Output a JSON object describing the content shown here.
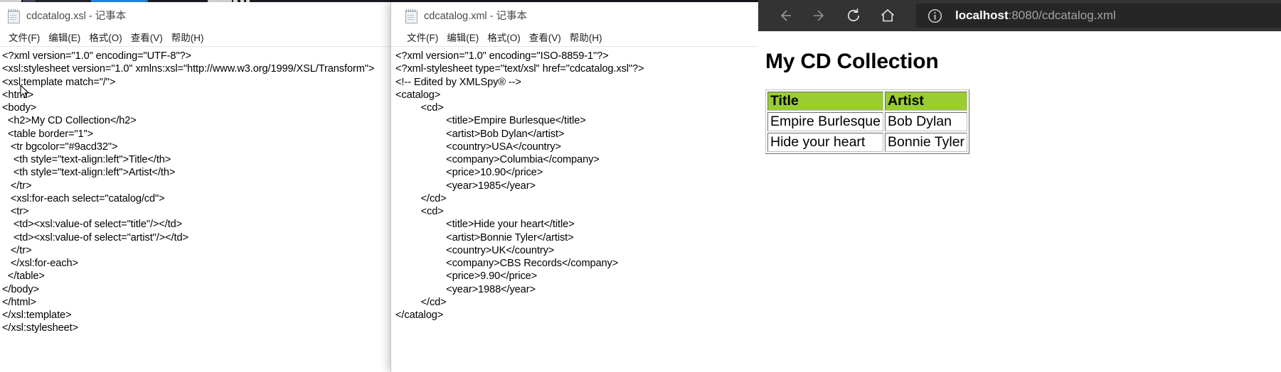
{
  "windows": {
    "notepad_xsl": {
      "title": "cdcatalog.xsl - 记事本",
      "icon": "notepad-icon",
      "menu": [
        "文件(F)",
        "编辑(E)",
        "格式(O)",
        "查看(V)",
        "帮助(H)"
      ],
      "content": "<?xml version=\"1.0\" encoding=\"UTF-8\"?>\n<xsl:stylesheet version=\"1.0\" xmlns:xsl=\"http://www.w3.org/1999/XSL/Transform\">\n<xsl:template match=\"/\">\n<html>\n<body>\n  <h2>My CD Collection</h2>\n  <table border=\"1\">\n   <tr bgcolor=\"#9acd32\">\n    <th style=\"text-align:left\">Title</th>\n    <th style=\"text-align:left\">Artist</th>\n   </tr>\n   <xsl:for-each select=\"catalog/cd\">\n   <tr>\n    <td><xsl:value-of select=\"title\"/></td>\n    <td><xsl:value-of select=\"artist\"/></td>\n   </tr>\n   </xsl:for-each>\n  </table>\n</body>\n</html>\n</xsl:template>\n</xsl:stylesheet>"
    },
    "notepad_xml": {
      "title": "cdcatalog.xml - 记事本",
      "icon": "notepad-icon",
      "menu": [
        "文件(F)",
        "编辑(E)",
        "格式(O)",
        "查看(V)",
        "帮助(H)"
      ],
      "content": "<?xml version=\"1.0\" encoding=\"ISO-8859-1\"?>\n<?xml-stylesheet type=\"text/xsl\" href=\"cdcatalog.xsl\"?>\n<!-- Edited by XMLSpy® -->\n<catalog>\n         <cd>\n                  <title>Empire Burlesque</title>\n                  <artist>Bob Dylan</artist>\n                  <country>USA</country>\n                  <company>Columbia</company>\n                  <price>10.90</price>\n                  <year>1985</year>\n         </cd>\n         <cd>\n                  <title>Hide your heart</title>\n                  <artist>Bonnie Tyler</artist>\n                  <country>UK</country>\n                  <company>CBS Records</company>\n                  <price>9.90</price>\n                  <year>1988</year>\n         </cd>\n</catalog>"
    },
    "browser": {
      "toolbar": {
        "back_label": "back-arrow",
        "forward_label": "forward-arrow",
        "refresh_label": "refresh",
        "home_label": "home"
      },
      "address": {
        "host": "localhost",
        "rest": ":8080/cdcatalog.xml",
        "full": "localhost:8080/cdcatalog.xml",
        "site_info_icon": "info-circle-icon"
      },
      "page": {
        "heading": "My CD Collection",
        "table": {
          "header_bgcolor": "#9acd32",
          "columns": [
            "Title",
            "Artist"
          ],
          "rows": [
            [
              "Empire Burlesque",
              "Bob Dylan"
            ],
            [
              "Hide your heart",
              "Bonnie Tyler"
            ]
          ]
        }
      }
    }
  },
  "colors": {
    "header_green": "#9acd32",
    "browser_chrome": "#333333",
    "address_bar": "#262626"
  }
}
